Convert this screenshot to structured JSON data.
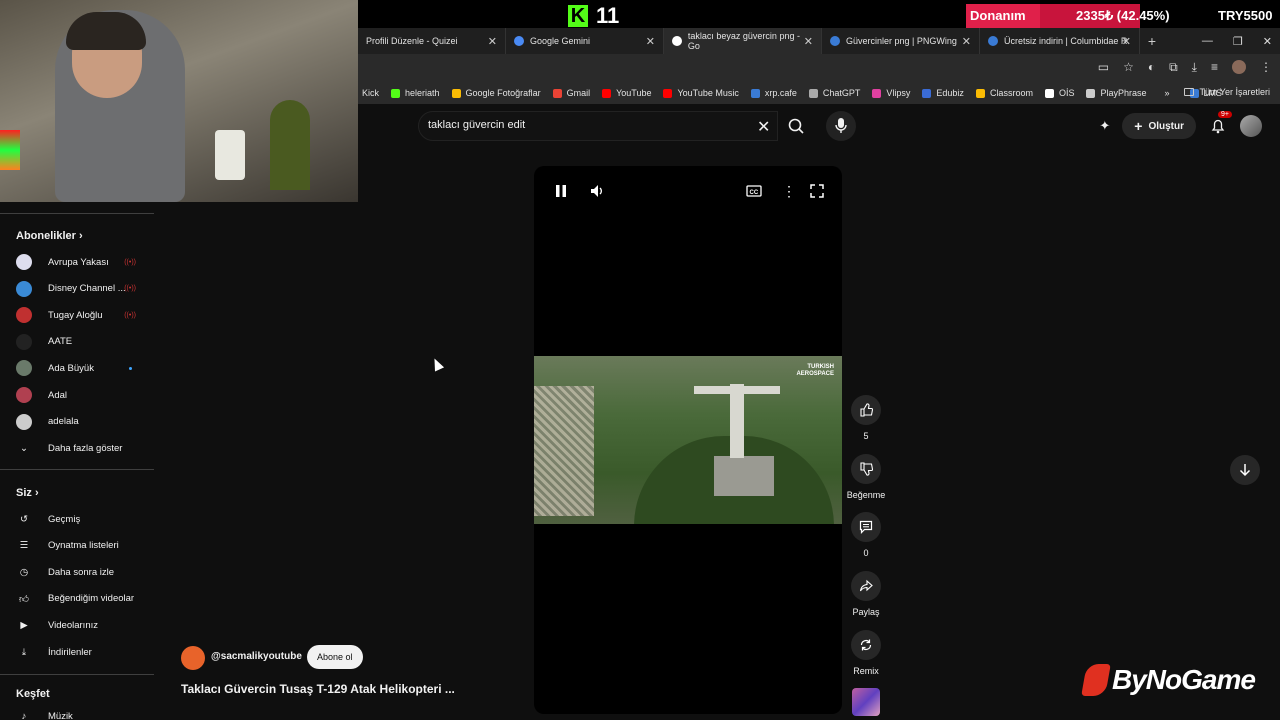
{
  "stream": {
    "kick_count": "11",
    "goal_label": "Donanım",
    "goal_value": "2335₺ (42.45%)",
    "goal_target": "TRY5500",
    "goal_fraction": 0.4245,
    "sponsor": "ByNoGame"
  },
  "browser": {
    "tabs": [
      {
        "label": "Profili Düzenle - Quizei",
        "icon_color": "#444"
      },
      {
        "label": "Google Gemini",
        "icon_color": "#4a8af4"
      },
      {
        "label": "taklacı beyaz güvercin png - Go",
        "icon_color": "#ffffff"
      },
      {
        "label": "Güvercinler png | PNGWing",
        "icon_color": "#3a7bd5"
      },
      {
        "label": "Ücretsiz indirin | Columbidae R",
        "icon_color": "#3a7bd5"
      }
    ],
    "bookmarks": [
      {
        "label": "Kick",
        "color": "#53fc18"
      },
      {
        "label": "heleriath",
        "color": "#53fc18"
      },
      {
        "label": "Google Fotoğraflar",
        "color": "#fbbc04"
      },
      {
        "label": "Gmail",
        "color": "#ea4335"
      },
      {
        "label": "YouTube",
        "color": "#ff0000"
      },
      {
        "label": "YouTube Music",
        "color": "#ff0000"
      },
      {
        "label": "xrp.cafe",
        "color": "#3a7bd5"
      },
      {
        "label": "ChatGPT",
        "color": "#aaaaaa"
      },
      {
        "label": "Vlipsy",
        "color": "#e040a0"
      },
      {
        "label": "Edubiz",
        "color": "#3a6bd5"
      },
      {
        "label": "Classroom",
        "color": "#fbbc04"
      },
      {
        "label": "OİS",
        "color": "#ffffff"
      },
      {
        "label": "PlayPhrase",
        "color": "#cccccc"
      },
      {
        "label": "LMS",
        "color": "#3a7bd5"
      }
    ],
    "all_bookmarks": "Tüm Yer İşaretleri"
  },
  "youtube": {
    "search_value": "taklacı güvercin edit",
    "create_label": "Oluştur",
    "notification_badge": "9+",
    "sidebar": {
      "subscriptions_title": "Abonelikler",
      "subscriptions": [
        {
          "label": "Avrupa Yakası",
          "live": true,
          "color": "#dde"
        },
        {
          "label": "Disney Channel ...",
          "live": true,
          "color": "#3a8ad5"
        },
        {
          "label": "Tugay Aloğlu",
          "live": true,
          "color": "#c03030"
        },
        {
          "label": "AATE",
          "live": false,
          "color": "#222"
        },
        {
          "label": "Ada Büyük",
          "live": false,
          "dot": true,
          "color": "#6a7a6a"
        },
        {
          "label": "Adal",
          "live": false,
          "color": "#b04050"
        },
        {
          "label": "adelala",
          "live": false,
          "color": "#ccc"
        }
      ],
      "show_more": "Daha fazla göster",
      "you_title": "Siz",
      "you_items": [
        {
          "label": "Geçmiş",
          "icon": "history-icon"
        },
        {
          "label": "Oynatma listeleri",
          "icon": "playlist-icon"
        },
        {
          "label": "Daha sonra izle",
          "icon": "clock-icon"
        },
        {
          "label": "Beğendiğim videolar",
          "icon": "like-icon"
        },
        {
          "label": "Videolarınız",
          "icon": "video-icon"
        },
        {
          "label": "İndirilenler",
          "icon": "download-icon"
        }
      ],
      "explore_title": "Keşfet",
      "explore_items": [
        {
          "label": "Müzik",
          "icon": "music-icon"
        }
      ]
    },
    "short": {
      "watermark": "TURKISH AEROSPACE",
      "channel": "@sacmalikyoutube",
      "subscribe_label": "Abone ol",
      "title": "Taklacı Güvercin Tusaş T-129 Atak Helikopteri ...",
      "likes": "5",
      "dislike_label": "Beğenme",
      "comments": "0",
      "share_label": "Paylaş",
      "remix_label": "Remix"
    }
  }
}
